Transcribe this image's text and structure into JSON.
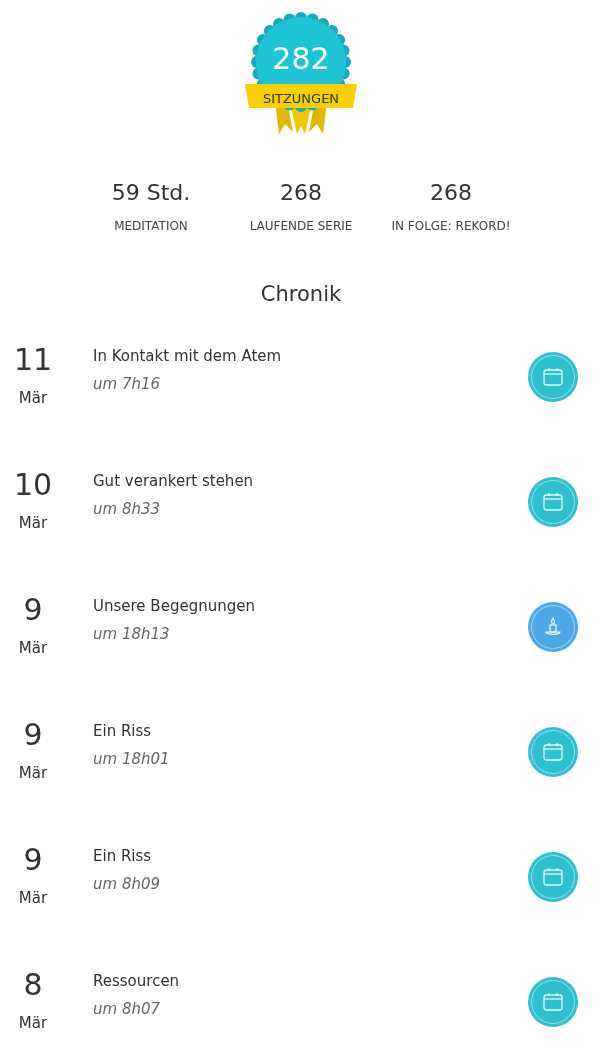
{
  "badge": {
    "count": "282",
    "label": "SITZUNGEN"
  },
  "stats": [
    {
      "value": "59 Std.",
      "label": "MEDITATION"
    },
    {
      "value": "268",
      "label": "LAUFENDE SERIE"
    },
    {
      "value": "268",
      "label": "IN FOLGE: REKORD!"
    }
  ],
  "section_title": "Chronik",
  "entries": [
    {
      "day": "11",
      "month": "Mär",
      "title": "In Kontakt mit dem Atem",
      "time": "um 7h16",
      "kind": "calendar",
      "color": "#2ec0cf"
    },
    {
      "day": "10",
      "month": "Mär",
      "title": "Gut verankert stehen",
      "time": "um 8h33",
      "kind": "calendar",
      "color": "#2ec0cf"
    },
    {
      "day": "9",
      "month": "Mär",
      "title": "Unsere Begegnungen",
      "time": "um 18h13",
      "kind": "candle",
      "color": "#4fa8e6"
    },
    {
      "day": "9",
      "month": "Mär",
      "title": "Ein Riss",
      "time": "um 18h01",
      "kind": "calendar",
      "color": "#2ec0cf"
    },
    {
      "day": "9",
      "month": "Mär",
      "title": "Ein Riss",
      "time": "um 8h09",
      "kind": "calendar",
      "color": "#2ec0cf"
    },
    {
      "day": "8",
      "month": "Mär",
      "title": "Ressourcen",
      "time": "um 8h07",
      "kind": "calendar",
      "color": "#2ec0cf"
    }
  ]
}
